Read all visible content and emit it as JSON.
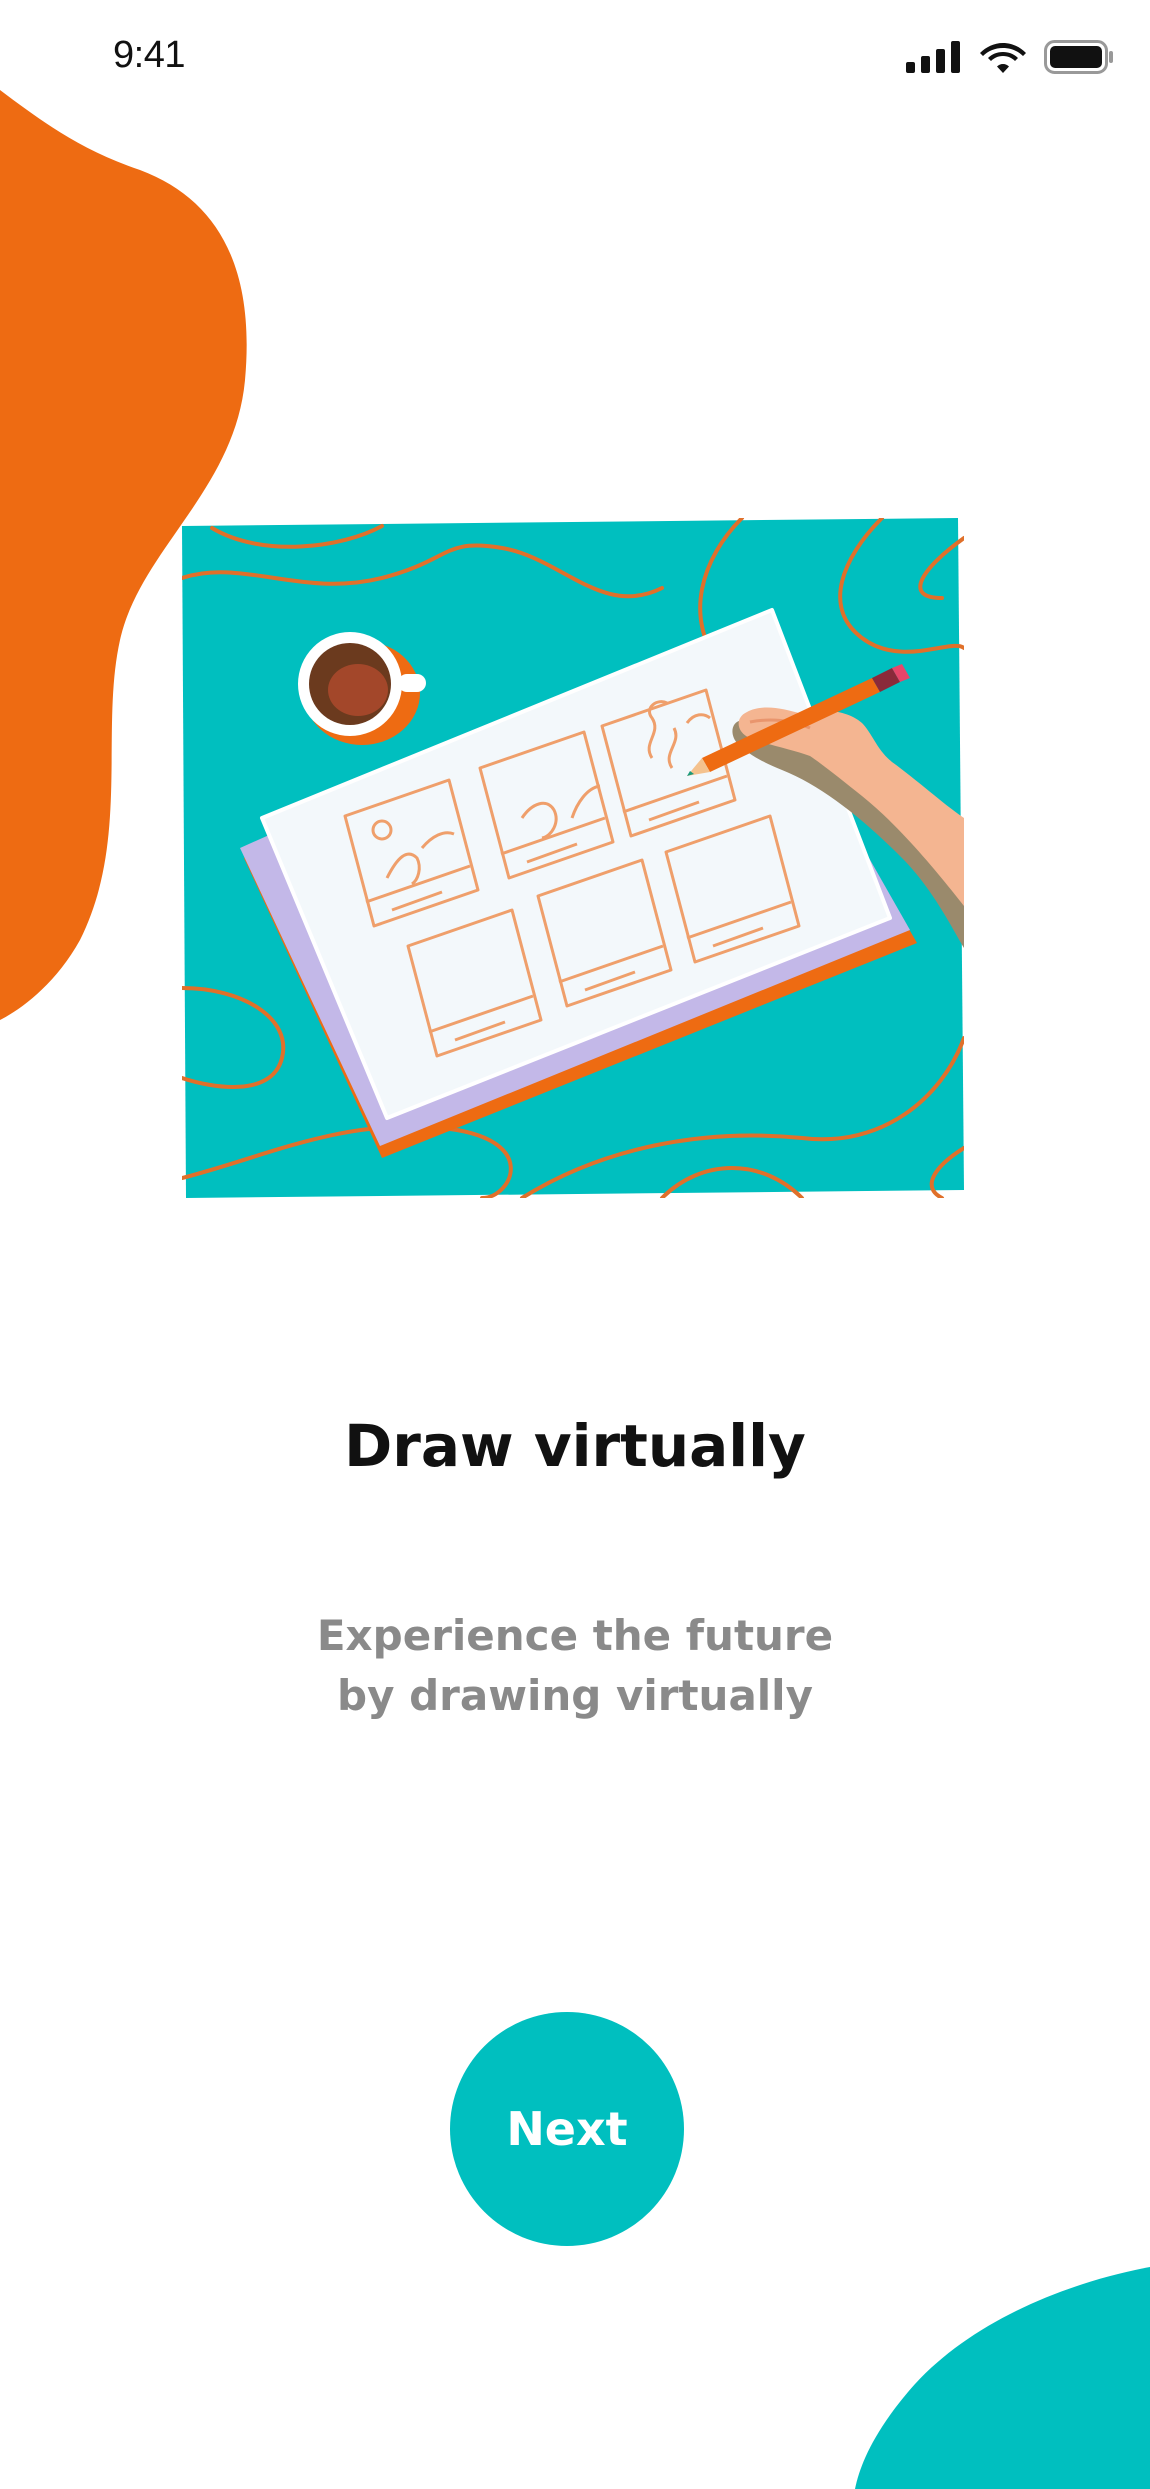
{
  "status_bar": {
    "time": "9:41",
    "icons": [
      "cellular-signal-icon",
      "wifi-icon",
      "battery-icon"
    ]
  },
  "illustration": {
    "name": "storyboard-drawing-illustration"
  },
  "content": {
    "title": "Draw virtually",
    "subtitle_line1": "Experience the future",
    "subtitle_line2": "by drawing virtually"
  },
  "actions": {
    "next_label": "Next"
  },
  "colors": {
    "accent_teal": "#00bfbf",
    "accent_orange": "#ee6b12",
    "title_text": "#111111",
    "subtitle_text": "#8a8a8a"
  }
}
